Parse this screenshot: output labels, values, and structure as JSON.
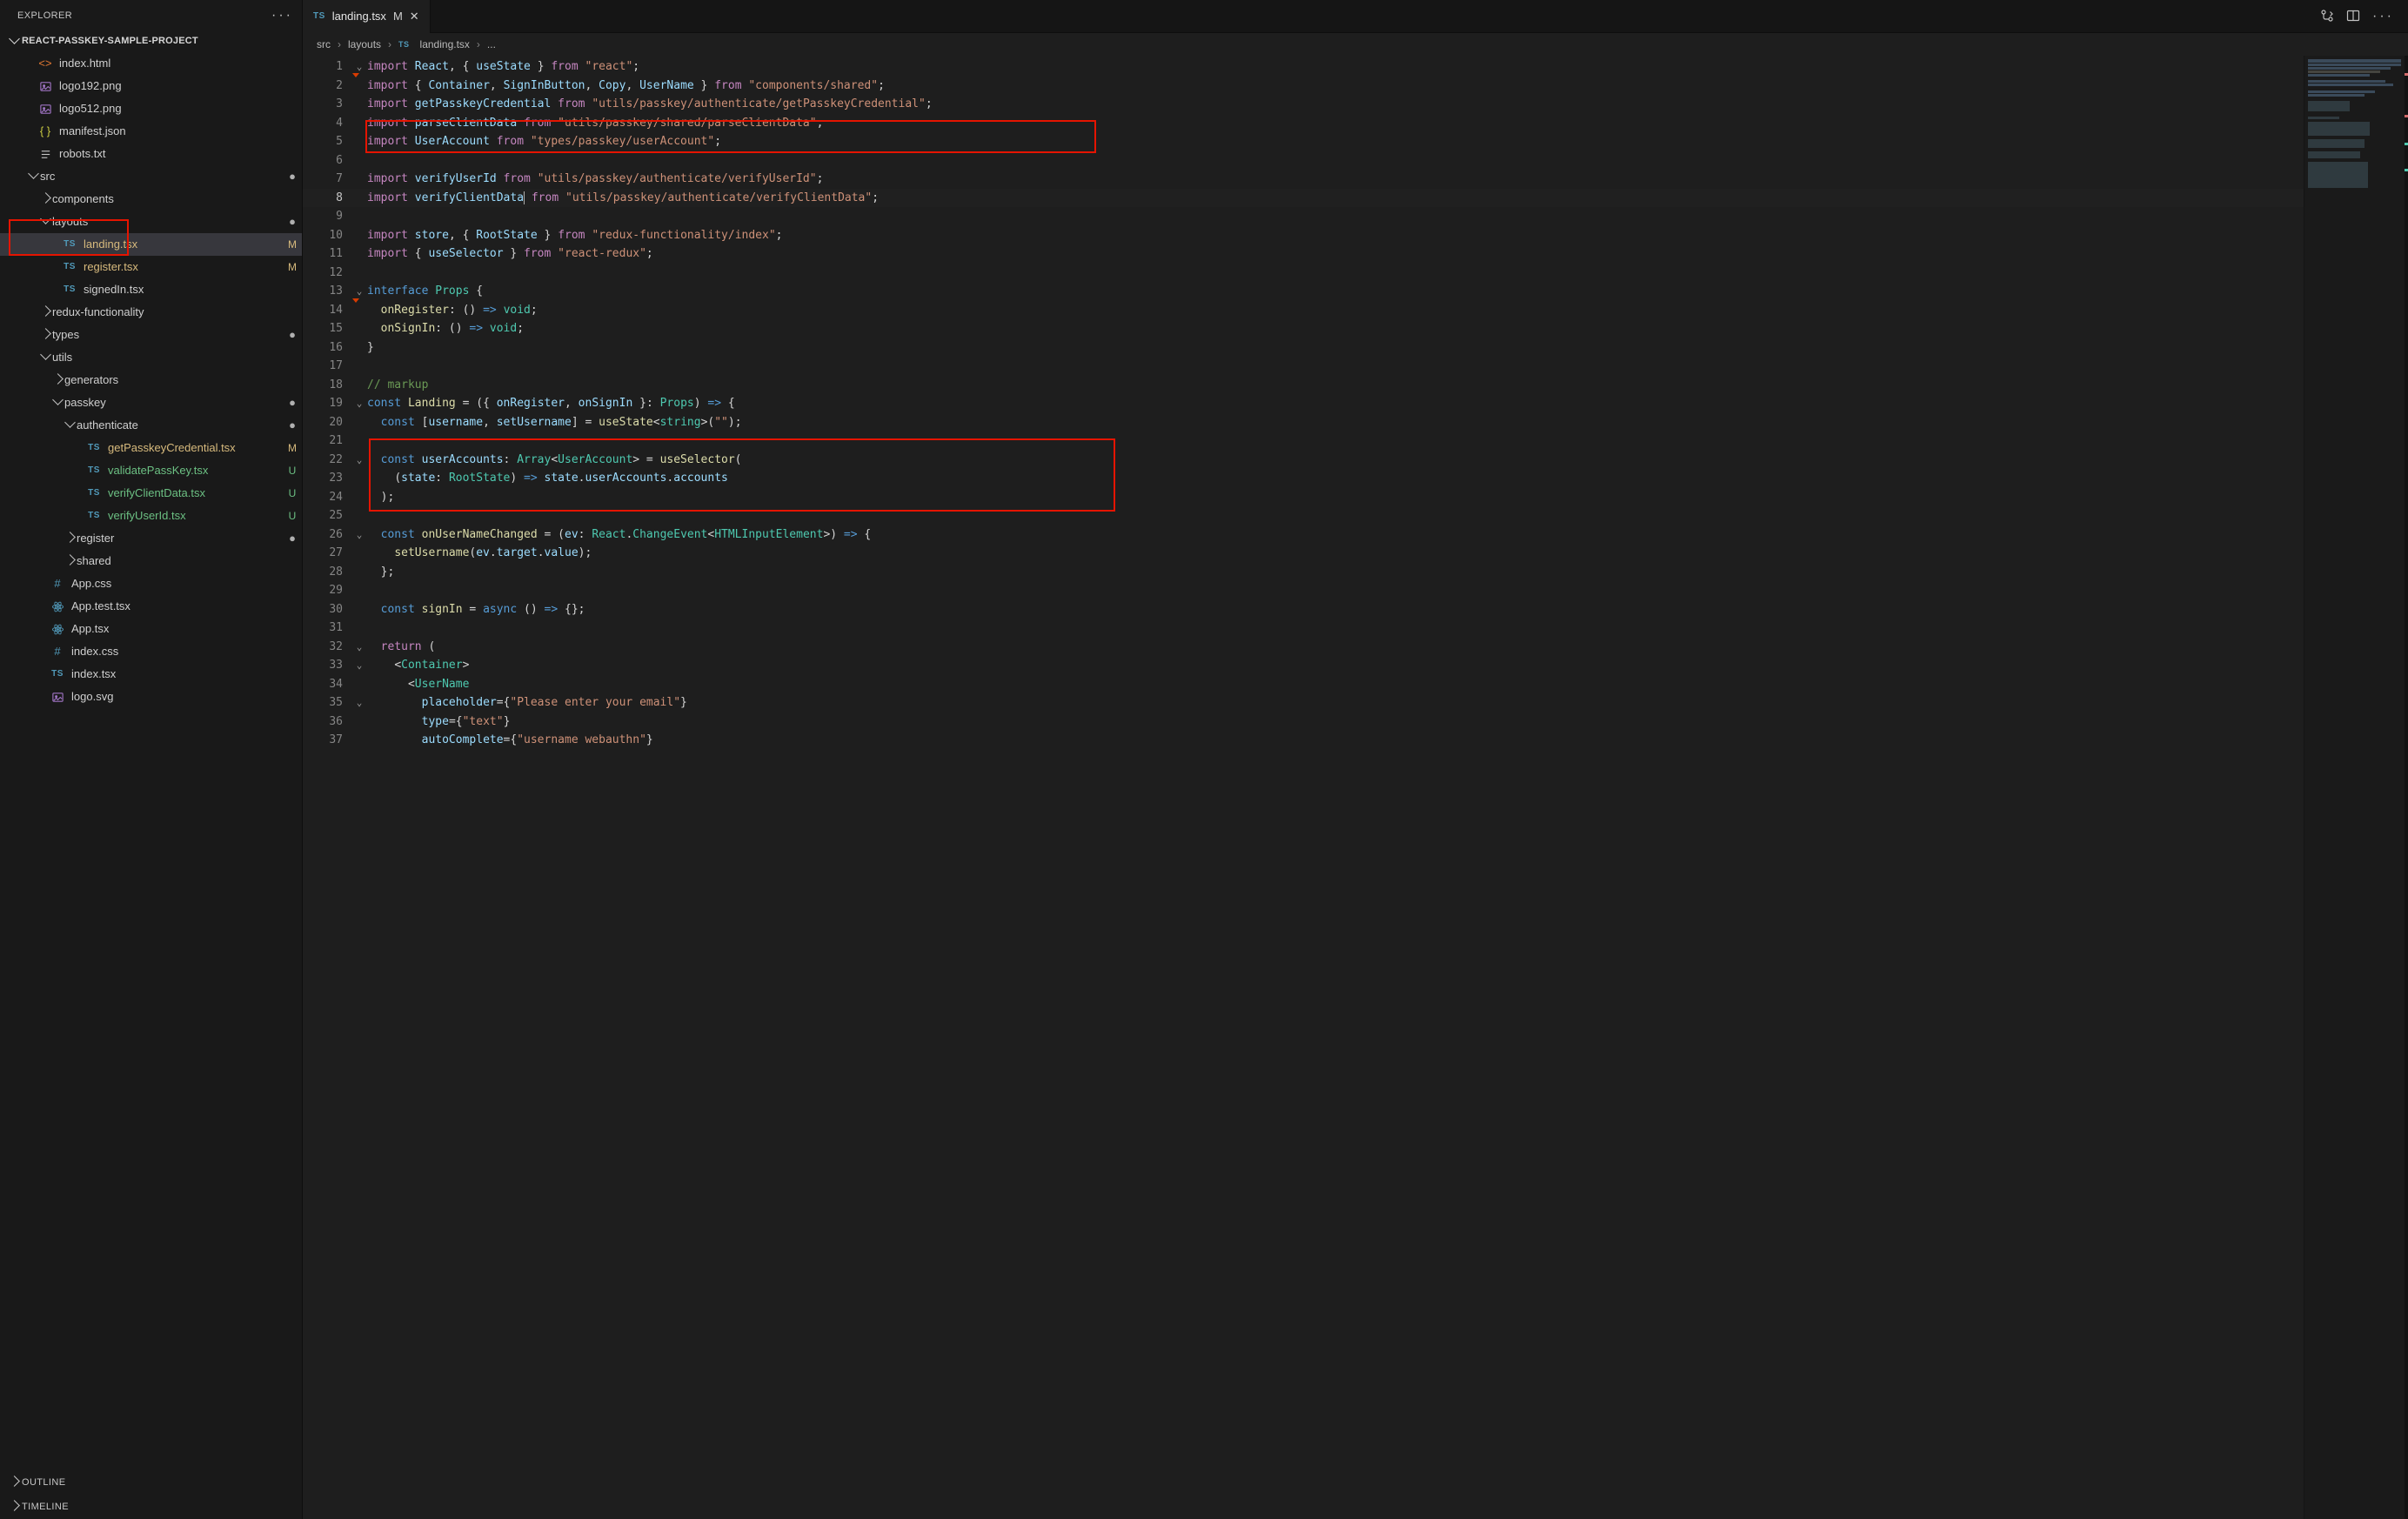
{
  "sidebar": {
    "title": "EXPLORER",
    "project": "REACT-PASSKEY-SAMPLE-PROJECT",
    "outline": "OUTLINE",
    "timeline": "TIMELINE",
    "tree": [
      {
        "depth": 1,
        "kind": "file",
        "icon": "html",
        "label": "index.html"
      },
      {
        "depth": 1,
        "kind": "file",
        "icon": "img",
        "label": "logo192.png"
      },
      {
        "depth": 1,
        "kind": "file",
        "icon": "img",
        "label": "logo512.png"
      },
      {
        "depth": 1,
        "kind": "file",
        "icon": "json",
        "label": "manifest.json"
      },
      {
        "depth": 1,
        "kind": "file",
        "icon": "txt",
        "label": "robots.txt"
      },
      {
        "depth": 1,
        "kind": "folder",
        "open": true,
        "label": "src",
        "dot": true
      },
      {
        "depth": 2,
        "kind": "folder",
        "open": false,
        "label": "components"
      },
      {
        "depth": 2,
        "kind": "folder",
        "open": true,
        "label": "layouts",
        "dot": true
      },
      {
        "depth": 3,
        "kind": "file",
        "icon": "ts",
        "label": "landing.tsx",
        "status": "M",
        "selected": true
      },
      {
        "depth": 3,
        "kind": "file",
        "icon": "ts",
        "label": "register.tsx",
        "status": "M"
      },
      {
        "depth": 3,
        "kind": "file",
        "icon": "ts",
        "label": "signedIn.tsx"
      },
      {
        "depth": 2,
        "kind": "folder",
        "open": false,
        "label": "redux-functionality"
      },
      {
        "depth": 2,
        "kind": "folder",
        "open": false,
        "label": "types",
        "dot": true
      },
      {
        "depth": 2,
        "kind": "folder",
        "open": true,
        "label": "utils"
      },
      {
        "depth": 3,
        "kind": "folder",
        "open": false,
        "label": "generators"
      },
      {
        "depth": 3,
        "kind": "folder",
        "open": true,
        "label": "passkey",
        "dot": true
      },
      {
        "depth": 4,
        "kind": "folder",
        "open": true,
        "label": "authenticate",
        "dot": true
      },
      {
        "depth": 5,
        "kind": "file",
        "icon": "ts",
        "label": "getPasskeyCredential.tsx",
        "status": "M"
      },
      {
        "depth": 5,
        "kind": "file",
        "icon": "ts",
        "label": "validatePassKey.tsx",
        "status": "U"
      },
      {
        "depth": 5,
        "kind": "file",
        "icon": "ts",
        "label": "verifyClientData.tsx",
        "status": "U"
      },
      {
        "depth": 5,
        "kind": "file",
        "icon": "ts",
        "label": "verifyUserId.tsx",
        "status": "U"
      },
      {
        "depth": 4,
        "kind": "folder",
        "open": false,
        "label": "register",
        "dot": true
      },
      {
        "depth": 4,
        "kind": "folder",
        "open": false,
        "label": "shared"
      },
      {
        "depth": 2,
        "kind": "file",
        "icon": "css",
        "label": "App.css"
      },
      {
        "depth": 2,
        "kind": "file",
        "icon": "react",
        "label": "App.test.tsx"
      },
      {
        "depth": 2,
        "kind": "file",
        "icon": "react",
        "label": "App.tsx"
      },
      {
        "depth": 2,
        "kind": "file",
        "icon": "css",
        "label": "index.css"
      },
      {
        "depth": 2,
        "kind": "file",
        "icon": "ts",
        "label": "index.tsx"
      },
      {
        "depth": 2,
        "kind": "file",
        "icon": "svg",
        "label": "logo.svg"
      }
    ]
  },
  "tab": {
    "file": "landing.tsx",
    "modified": "M"
  },
  "crumbs": {
    "seg1": "src",
    "seg2": "layouts",
    "seg3": "landing.tsx",
    "seg4": "..."
  },
  "code": {
    "s_react": "\"react\"",
    "s_comp": "\"components/shared\"",
    "s_getPC": "\"utils/passkey/authenticate/getPasskeyCredential\"",
    "s_parse": "\"utils/passkey/shared/parseClientData\"",
    "s_userAcc": "\"types/passkey/userAccount\"",
    "s_verU": "\"utils/passkey/authenticate/verifyUserId\"",
    "s_verC": "\"utils/passkey/authenticate/verifyClientData\"",
    "s_redux": "\"redux-functionality/index\"",
    "s_rr": "\"react-redux\"",
    "s_empty": "\"\"",
    "s_placeholder": "\"Please enter your email\"",
    "s_text": "\"text\"",
    "s_autoc": "\"username webauthn\"",
    "comment": "// markup"
  }
}
